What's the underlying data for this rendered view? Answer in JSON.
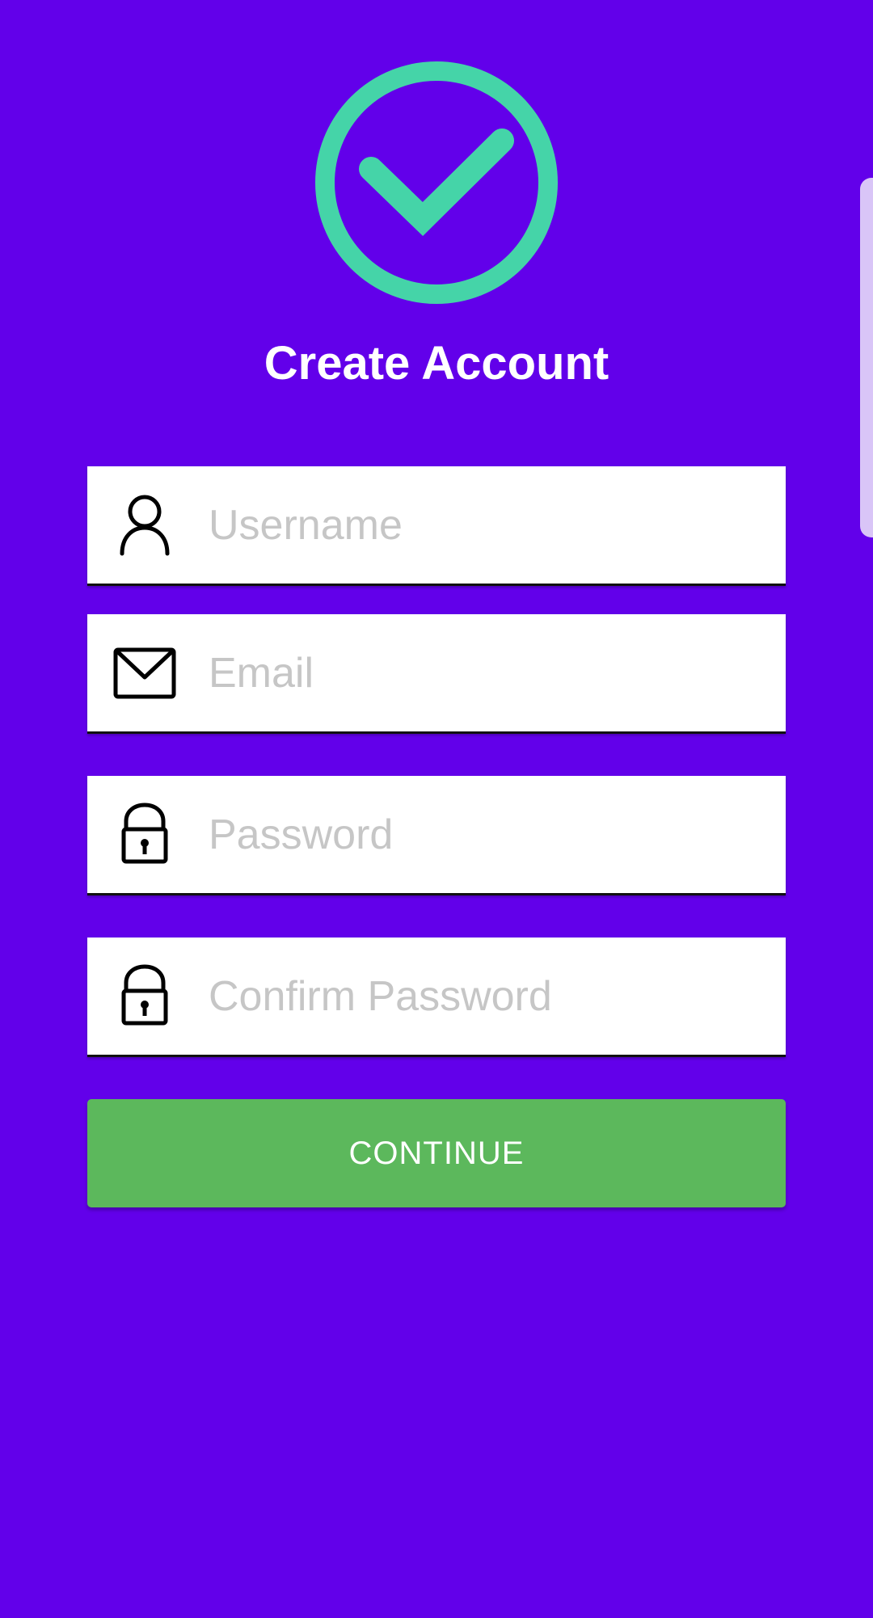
{
  "header": {
    "logo_icon": "check-circle-icon",
    "title": "Create Account"
  },
  "form": {
    "fields": [
      {
        "icon": "person-icon",
        "placeholder": "Username",
        "value": ""
      },
      {
        "icon": "envelope-icon",
        "placeholder": "Email",
        "value": ""
      },
      {
        "icon": "lock-icon",
        "placeholder": "Password",
        "value": ""
      },
      {
        "icon": "lock-icon",
        "placeholder": "Confirm Password",
        "value": ""
      }
    ],
    "continue_label": "CONTINUE"
  },
  "colors": {
    "background": "#6200EA",
    "accent": "#45D4A8",
    "button": "#5CB85C",
    "field_bg": "#FFFFFF",
    "placeholder": "#C6C6C6"
  }
}
